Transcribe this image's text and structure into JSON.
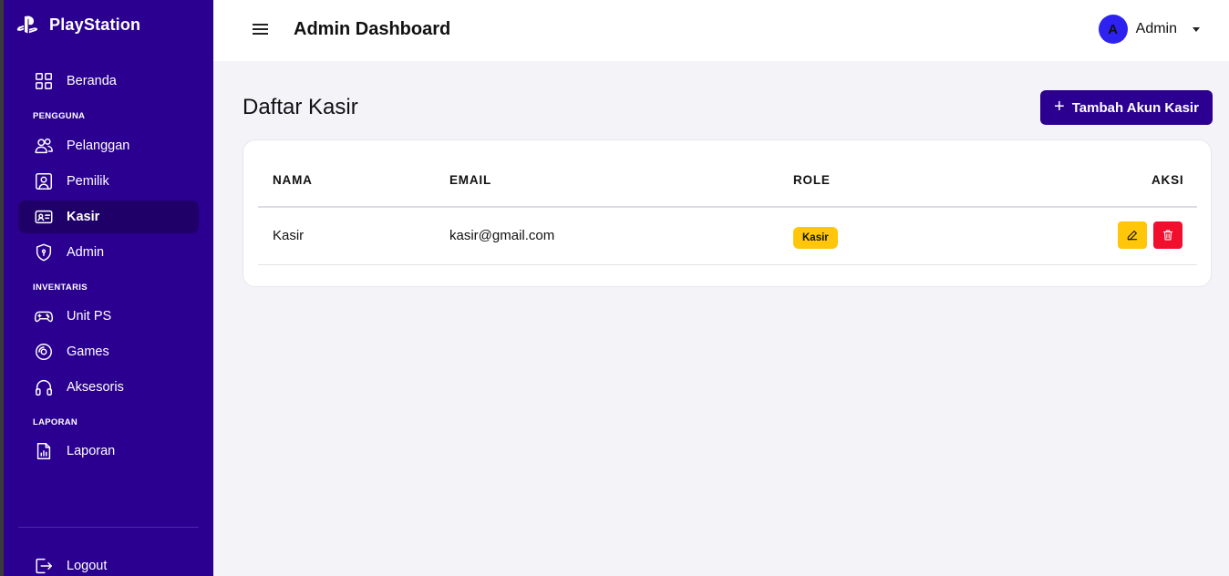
{
  "sidebar": {
    "brand": "PlayStation",
    "items": {
      "beranda": "Beranda",
      "pelanggan": "Pelanggan",
      "pemilik": "Pemilik",
      "kasir": "Kasir",
      "admin": "Admin",
      "unit_ps": "Unit PS",
      "games": "Games",
      "aksesoris": "Aksesoris",
      "laporan": "Laporan",
      "logout": "Logout"
    },
    "sections": {
      "pengguna": "PENGGUNA",
      "inventaris": "INVENTARIS",
      "laporan": "LAPORAN"
    },
    "active_item": "Kasir"
  },
  "topbar": {
    "title": "Admin Dashboard",
    "user_initial": "A",
    "user_name": "Admin"
  },
  "main": {
    "heading": "Daftar Kasir",
    "add_button": "Tambah Akun Kasir",
    "table": {
      "headers": [
        "NAMA",
        "EMAIL",
        "ROLE",
        "AKSI"
      ],
      "rows": [
        {
          "nama": "Kasir",
          "email": "kasir@gmail.com",
          "role": "Kasir"
        }
      ]
    }
  },
  "colors": {
    "sidebar_bg": "#2b0090",
    "active_item_bg": "#1f0068",
    "role_badge": "#ffc60a",
    "edit_button": "#ffc60a",
    "delete_button": "#f0102e",
    "avatar": "#2e22f0"
  }
}
